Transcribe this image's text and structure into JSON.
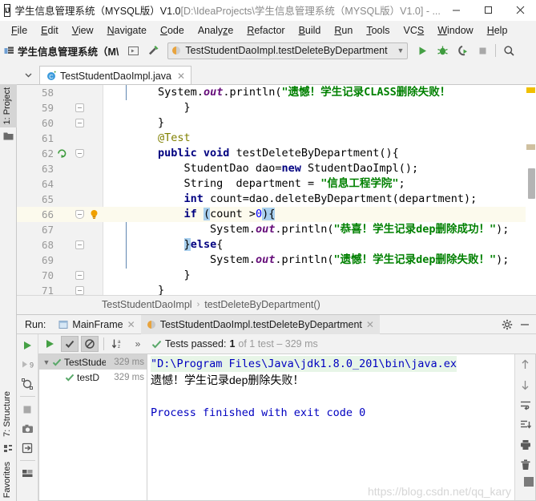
{
  "window": {
    "title_project": "学生信息管理系统（MYSQL版）V1.0",
    "title_path": "[D:\\IdeaProjects\\学生信息管理系统（MYSQL版）V1.0] - ...",
    "logo": "intellij-idea-logo",
    "minimize_label": "—",
    "maximize_label": "□",
    "close_label": "✕"
  },
  "menubar": {
    "items": [
      {
        "label": "File",
        "mnemonic": "F"
      },
      {
        "label": "Edit",
        "mnemonic": "E"
      },
      {
        "label": "View",
        "mnemonic": "V"
      },
      {
        "label": "Navigate",
        "mnemonic": "N"
      },
      {
        "label": "Code",
        "mnemonic": "C"
      },
      {
        "label": "Analyze",
        "mnemonic": "z"
      },
      {
        "label": "Refactor",
        "mnemonic": "R"
      },
      {
        "label": "Build",
        "mnemonic": "B"
      },
      {
        "label": "Run",
        "mnemonic": "R"
      },
      {
        "label": "Tools",
        "mnemonic": "T"
      },
      {
        "label": "VCS",
        "mnemonic": "S"
      },
      {
        "label": "Window",
        "mnemonic": "W"
      },
      {
        "label": "Help",
        "mnemonic": "H"
      }
    ]
  },
  "toolbar": {
    "project_name": "学生信息管理系统（M\\",
    "run_configuration": "TestStudentDaoImpl.testDeleteByDepartment",
    "buttons": [
      "project-structure-icon",
      "build-hammer-icon",
      "run-icon",
      "debug-icon",
      "run-with-coverage-icon",
      "stop-icon",
      "search-everywhere-icon"
    ]
  },
  "left_stripe": {
    "top_item": "1: Project",
    "bottom_items": [
      "7: Structure",
      "Favorites"
    ]
  },
  "editor": {
    "tab_label": "TestStudentDaoImpl.java",
    "tab_close": "✕",
    "first_line_number": 58,
    "highlighted_line": 66,
    "lines": [
      {
        "n": 58,
        "indent": 0,
        "tokens": [
          {
            "t": "        ",
            "c": "pl"
          },
          {
            "t": "System.",
            "c": "pl"
          },
          {
            "t": "out",
            "c": "fld"
          },
          {
            "t": ".println(",
            "c": "pl"
          },
          {
            "t": "\"遗憾！学生记录CLASS删除失败！",
            "c": "str"
          }
        ]
      },
      {
        "n": 59,
        "indent": 0,
        "tokens": [
          {
            "t": "            }",
            "c": "pl"
          }
        ],
        "fold": true
      },
      {
        "n": 60,
        "indent": 0,
        "tokens": [
          {
            "t": "        }",
            "c": "pl"
          }
        ],
        "fold": true
      },
      {
        "n": 61,
        "indent": 0,
        "tokens": [
          {
            "t": "        @Test",
            "c": "anno"
          }
        ]
      },
      {
        "n": 62,
        "indent": 0,
        "gutter_icon": "run-test-icon",
        "tokens": [
          {
            "t": "        ",
            "c": "pl"
          },
          {
            "t": "public void ",
            "c": "kw"
          },
          {
            "t": "testDeleteByDepartment(){",
            "c": "pl"
          }
        ],
        "fold": true
      },
      {
        "n": 63,
        "indent": 0,
        "tokens": [
          {
            "t": "            StudentDao dao=",
            "c": "pl"
          },
          {
            "t": "new ",
            "c": "kw"
          },
          {
            "t": "StudentDaoImpl();",
            "c": "pl"
          }
        ]
      },
      {
        "n": 64,
        "indent": 0,
        "tokens": [
          {
            "t": "            String  department = ",
            "c": "pl"
          },
          {
            "t": "\"信息工程学院\"",
            "c": "str"
          },
          {
            "t": ";",
            "c": "pl"
          }
        ]
      },
      {
        "n": 65,
        "indent": 0,
        "tokens": [
          {
            "t": "            ",
            "c": "pl"
          },
          {
            "t": "int ",
            "c": "kw"
          },
          {
            "t": "count=dao.deleteByDepartment(department);",
            "c": "pl"
          }
        ]
      },
      {
        "n": 66,
        "indent": 0,
        "gutter_icon": "intention-bulb-icon",
        "highlight": true,
        "tokens": [
          {
            "t": "            ",
            "c": "pl"
          },
          {
            "t": "if ",
            "c": "kw"
          },
          {
            "t": "(",
            "c": "sel"
          },
          {
            "t": "count >",
            "c": "pl"
          },
          {
            "t": "0",
            "c": "num"
          },
          {
            "t": "){",
            "c": "sel"
          }
        ],
        "fold": true
      },
      {
        "n": 67,
        "indent": 0,
        "tokens": [
          {
            "t": "                System.",
            "c": "pl"
          },
          {
            "t": "out",
            "c": "fld"
          },
          {
            "t": ".println(",
            "c": "pl"
          },
          {
            "t": "\"恭喜！学生记录dep删除成功！\"",
            "c": "str"
          },
          {
            "t": ");",
            "c": "pl"
          }
        ]
      },
      {
        "n": 68,
        "indent": 0,
        "tokens": [
          {
            "t": "            ",
            "c": "pl"
          },
          {
            "t": "}",
            "c": "sel"
          },
          {
            "t": "else",
            "c": "kw"
          },
          {
            "t": "{",
            "c": "pl"
          }
        ],
        "fold": true
      },
      {
        "n": 69,
        "indent": 0,
        "tokens": [
          {
            "t": "                System.",
            "c": "pl"
          },
          {
            "t": "out",
            "c": "fld"
          },
          {
            "t": ".println(",
            "c": "pl"
          },
          {
            "t": "\"遗憾！学生记录dep删除失败！\"",
            "c": "str"
          },
          {
            "t": ");",
            "c": "pl"
          }
        ]
      },
      {
        "n": 70,
        "indent": 0,
        "tokens": [
          {
            "t": "            }",
            "c": "pl"
          }
        ],
        "fold": true
      },
      {
        "n": 71,
        "indent": 0,
        "tokens": [
          {
            "t": "        }",
            "c": "pl"
          }
        ],
        "fold": true
      }
    ]
  },
  "breadcrumb": {
    "items": [
      "TestStudentDaoImpl",
      "testDeleteByDepartment()"
    ],
    "separator": "›"
  },
  "run_panel": {
    "label": "Run:",
    "tabs": [
      {
        "label": "MainFrame",
        "icon": "app-icon",
        "active": false,
        "close": "✕"
      },
      {
        "label": "TestStudentDaoImpl.testDeleteByDepartment",
        "icon": "test-icon",
        "active": true,
        "close": "✕"
      }
    ],
    "tab_tools": [
      "settings-gear-icon",
      "minimize-icon"
    ],
    "left_tools": [
      "rerun-icon",
      "rerun-failed-icon",
      "toggle-auto-test-icon",
      "stop-icon",
      "screenshot-icon",
      "export-icon",
      "layout-icon"
    ],
    "tests_toolbar": {
      "rerun_icon": "run-icon",
      "show_passed_label": "✓",
      "show_ignored_label": "⊘",
      "sort_label": "↓az",
      "more_label": "»",
      "status_prefix": "Tests passed:",
      "status_count": "1",
      "status_suffix": "of 1 test – 329 ms"
    },
    "test_tree": [
      {
        "name": "TestStudentDaoImpl",
        "time": "329 ms",
        "level": 0,
        "selected": true,
        "status": "passed"
      },
      {
        "name": "testDeleteByDepartment",
        "time": "329 ms",
        "level": 1,
        "selected": false,
        "status": "passed"
      }
    ],
    "console": [
      {
        "text": "\"D:\\Program Files\\Java\\jdk1.8.0_201\\bin\\java.ex",
        "style": "cmd"
      },
      {
        "text": "遗憾！学生记录dep删除失败！",
        "style": "out"
      },
      {
        "text": "",
        "style": "blank"
      },
      {
        "text": "Process finished with exit code 0",
        "style": "fin"
      }
    ],
    "console_tools": [
      "scroll-up-icon",
      "scroll-down-icon",
      "soft-wrap-icon",
      "scroll-to-end-icon",
      "print-icon",
      "trash-icon"
    ]
  },
  "watermark": "https://blog.csdn.net/qq_kary",
  "colors": {
    "accent_green": "#3c9e3c",
    "string_green": "#008000",
    "keyword_blue": "#000080",
    "field_purple": "#660e7a",
    "annotation_olive": "#808000",
    "highlight_yellow": "#fcfaed",
    "selection_blue": "#a8cfee",
    "console_cmd_bg": "#e7f5e7",
    "console_blue": "#0000c0"
  }
}
